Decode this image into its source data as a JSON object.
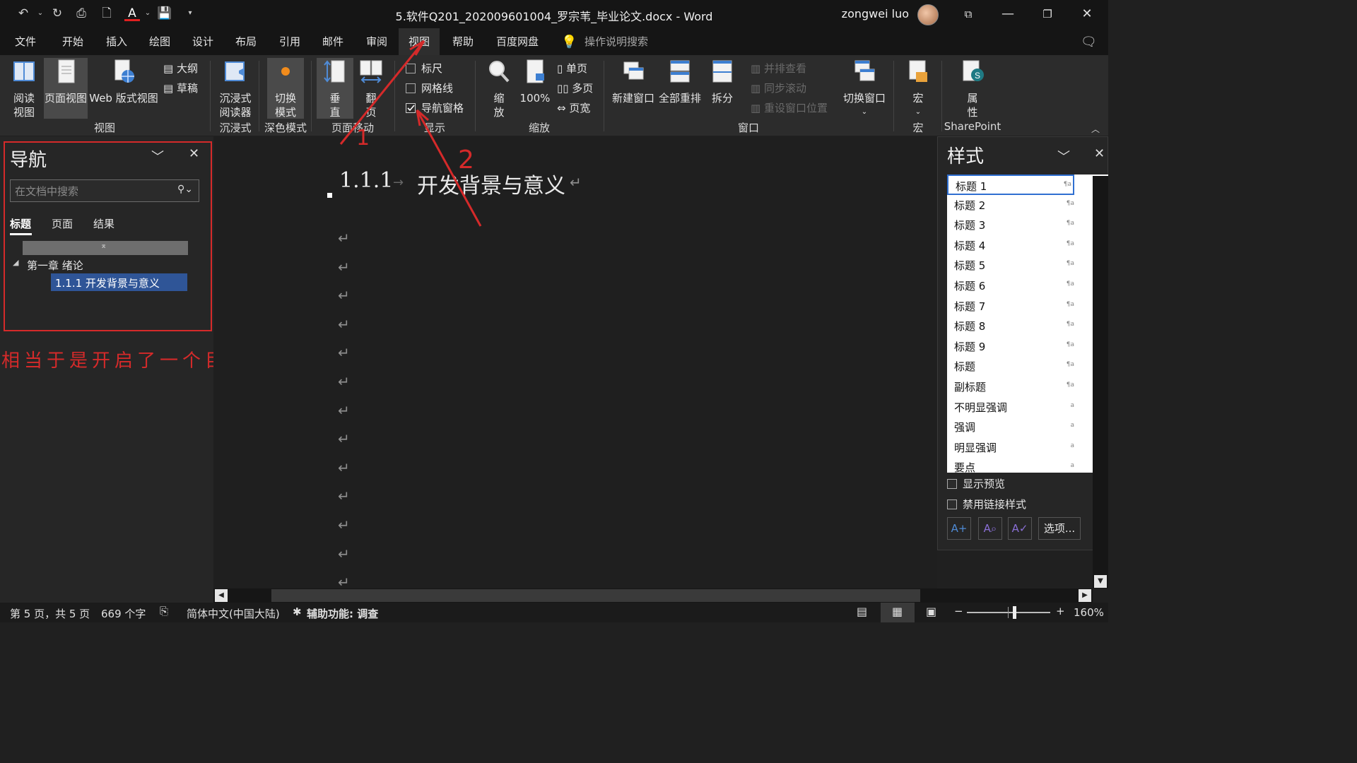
{
  "window": {
    "title": "5.软件Q201_202009601004_罗宗苇_毕业论文.docx  -  Word",
    "user": "zongwei luo"
  },
  "menu": [
    "文件",
    "开始",
    "插入",
    "绘图",
    "设计",
    "布局",
    "引用",
    "邮件",
    "审阅",
    "视图",
    "帮助",
    "百度网盘"
  ],
  "menu_active": "视图",
  "tell_me": "操作说明搜索",
  "ribbon": {
    "views": {
      "read": "阅读\n视图",
      "print": "页面视图",
      "web": "Web 版式视图",
      "outline": "大纲",
      "draft": "草稿",
      "label": "视图"
    },
    "immersive": {
      "reader": "沉浸式\n阅读器",
      "label": "沉浸式"
    },
    "dark": {
      "toggle": "切换\n模式",
      "label": "深色模式"
    },
    "pagemove": {
      "vertical": "垂\n直",
      "side": "翻\n页",
      "label": "页面移动"
    },
    "show": {
      "ruler": "标尺",
      "gridlines": "网格线",
      "navpane": "导航窗格",
      "label": "显示"
    },
    "zoom": {
      "zoom": "缩\n放",
      "hundred": "100%",
      "one": "单页",
      "multi": "多页",
      "width": "页宽",
      "label": "缩放"
    },
    "window": {
      "new": "新建窗口",
      "arrange": "全部重排",
      "split": "拆分",
      "side": "并排查看",
      "sync": "同步滚动",
      "reset": "重设窗口位置",
      "switch": "切换窗口",
      "label": "窗口"
    },
    "macros": {
      "macro": "宏",
      "label": "宏"
    },
    "sharepoint": {
      "props": "属\n性",
      "label": "SharePoint"
    }
  },
  "nav": {
    "title": "导航",
    "search_placeholder": "在文档中搜索",
    "tabs": [
      "标题",
      "页面",
      "结果"
    ],
    "chapter": "第一章 绪论",
    "section": "1.1.1 开发背景与意义"
  },
  "annotation": {
    "text": "相当于是开启了一个目录",
    "marks": [
      "1",
      "2"
    ]
  },
  "document": {
    "heading_number": "1.1.1",
    "heading_text": "开发背景与意义",
    "para_mark": "↵"
  },
  "styles": {
    "title": "样式",
    "items": [
      "标题 1",
      "标题 2",
      "标题 3",
      "标题 4",
      "标题 5",
      "标题 6",
      "标题 7",
      "标题 8",
      "标题 9",
      "标题",
      "副标题",
      "不明显强调",
      "强调",
      "明显强调",
      "要点"
    ],
    "show_preview": "显示预览",
    "disable_linked": "禁用链接样式",
    "options": "选项..."
  },
  "status": {
    "page": "第 5 页，共 5 页",
    "words": "669 个字",
    "lang": "简体中文(中国大陆)",
    "accessibility": "辅助功能: 调查",
    "zoom": "160%"
  },
  "colors": {
    "annotation_red": "#d52a2a",
    "nav_selected": "#2f5597"
  }
}
